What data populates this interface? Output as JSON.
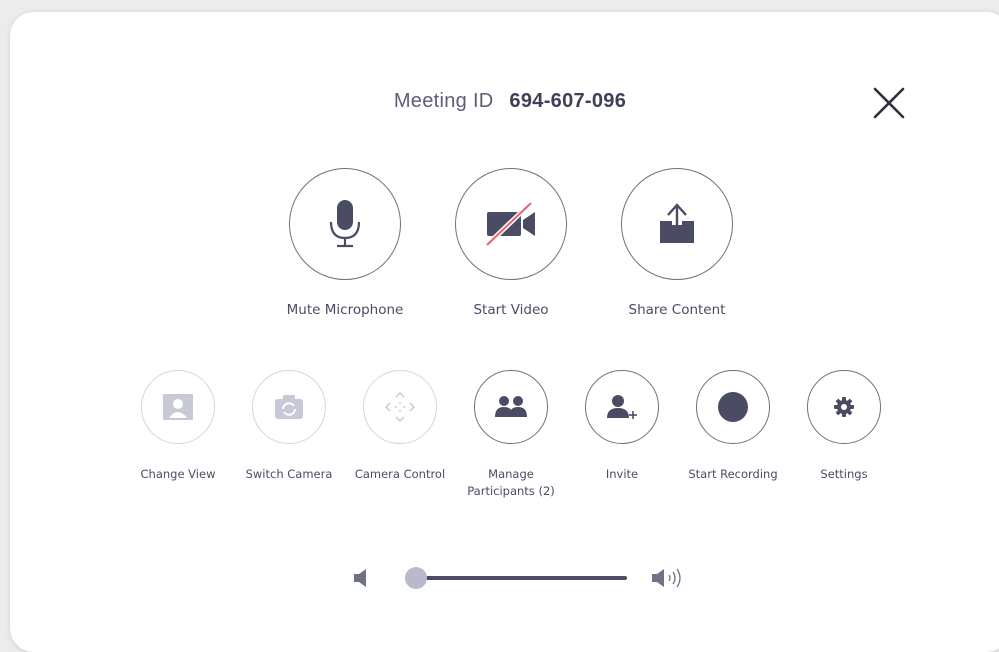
{
  "header": {
    "meeting_id_label": "Meeting ID",
    "meeting_id_value": "694-607-096"
  },
  "primary_controls": [
    {
      "label": "Mute Microphone",
      "icon": "microphone-icon"
    },
    {
      "label": "Start Video",
      "icon": "video-off-icon"
    },
    {
      "label": "Share Content",
      "icon": "share-icon"
    }
  ],
  "secondary_controls": [
    {
      "label": "Change View",
      "icon": "change-view-icon",
      "enabled": false
    },
    {
      "label": "Switch Camera",
      "icon": "switch-camera-icon",
      "enabled": false
    },
    {
      "label": "Camera Control",
      "icon": "camera-control-icon",
      "enabled": false
    },
    {
      "label_line1": "Manage",
      "label_line2": "Participants (2)",
      "icon": "participants-icon",
      "enabled": true
    },
    {
      "label": "Invite",
      "icon": "invite-icon",
      "enabled": true
    },
    {
      "label": "Start Recording",
      "icon": "record-icon",
      "enabled": true
    },
    {
      "label": "Settings",
      "icon": "gear-icon",
      "enabled": true
    }
  ],
  "volume": {
    "level": 0.05
  },
  "colors": {
    "icon": "#4a4c63",
    "disabled_icon": "#c8c9d6",
    "slash": "#e8626e",
    "border": "#6f7185"
  }
}
